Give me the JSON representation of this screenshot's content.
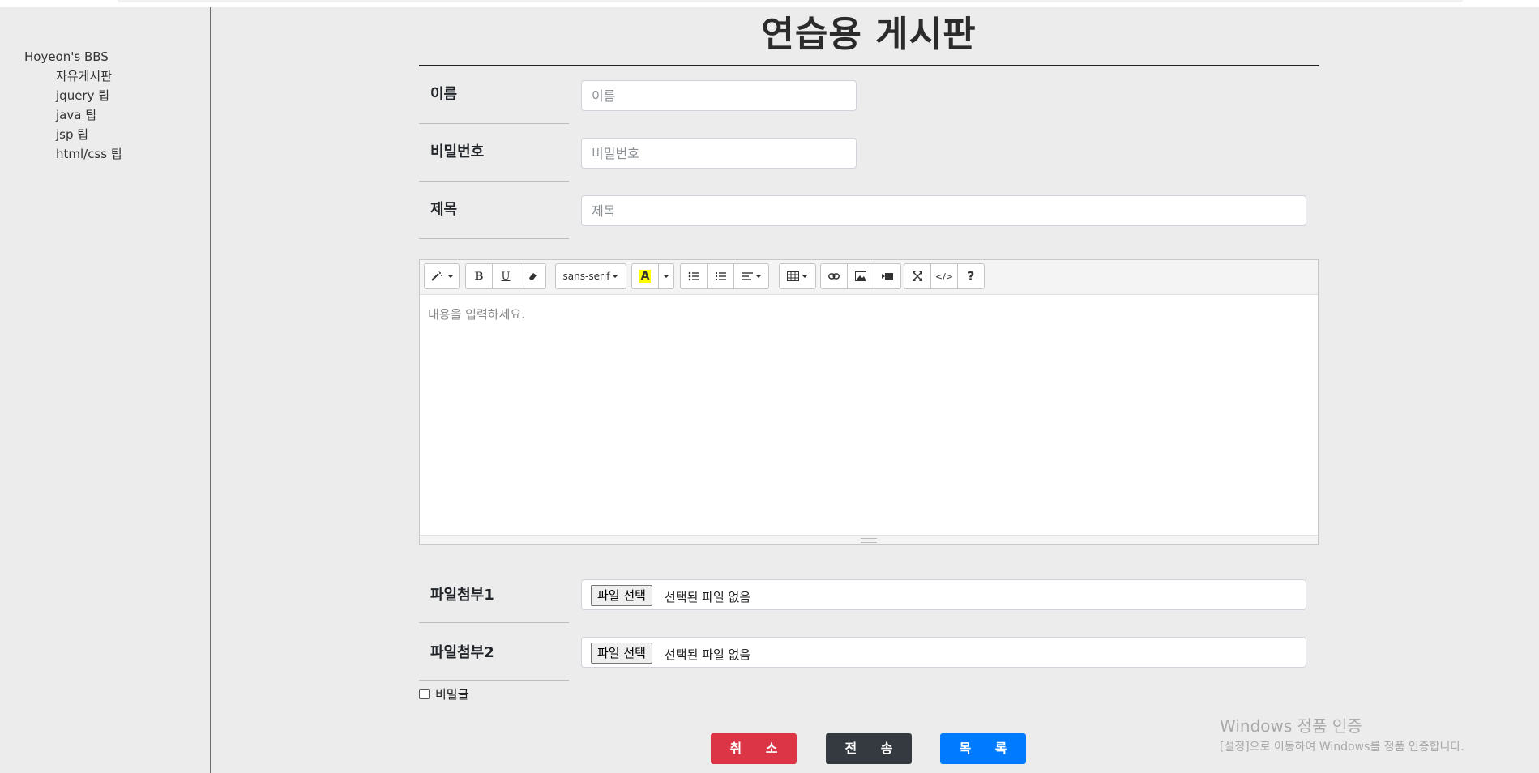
{
  "sidebar": {
    "site_title": "Hoyeon's BBS",
    "items": [
      "자유게시판",
      "jquery 팁",
      "java 팁",
      "jsp 팁",
      "html/css 팁"
    ]
  },
  "page": {
    "title": "연습용 게시판"
  },
  "form": {
    "name": {
      "label": "이름",
      "placeholder": "이름"
    },
    "password": {
      "label": "비밀번호",
      "placeholder": "비밀번호"
    },
    "subject": {
      "label": "제목",
      "placeholder": "제목"
    },
    "file1": {
      "label": "파일첨부1",
      "button": "파일 선택",
      "status": "선택된 파일 없음"
    },
    "file2": {
      "label": "파일첨부2",
      "button": "파일 선택",
      "status": "선택된 파일 없음"
    },
    "secret": {
      "label": "비밀글",
      "checked": false
    }
  },
  "editor": {
    "placeholder": "내용을 입력하세요.",
    "font_name": "sans-serif",
    "toolbar_icons": [
      "magic-icon",
      "bold-icon",
      "underline-icon",
      "eraser-icon",
      "font-name-dropdown",
      "text-color-icon",
      "color-dropdown-icon",
      "unordered-list-icon",
      "ordered-list-icon",
      "paragraph-align-icon",
      "table-icon",
      "link-icon",
      "picture-icon",
      "video-icon",
      "fullscreen-icon",
      "code-view-icon",
      "help-icon"
    ],
    "bold_glyph": "B",
    "underline_glyph": "U",
    "color_glyph": "A",
    "code_glyph": "</>",
    "help_glyph": "?",
    "colors": {
      "highlight": "#ffff00"
    }
  },
  "buttons": {
    "cancel": "취 소",
    "submit": "전 송",
    "list": "목 록"
  },
  "colors": {
    "cancel": "#dc3545",
    "submit": "#343a40",
    "list": "#007bff",
    "background": "#ececec"
  },
  "watermark": {
    "line1": "Windows 정품 인증",
    "line2": "[설정]으로 이동하여 Windows를 정품 인증합니다."
  }
}
